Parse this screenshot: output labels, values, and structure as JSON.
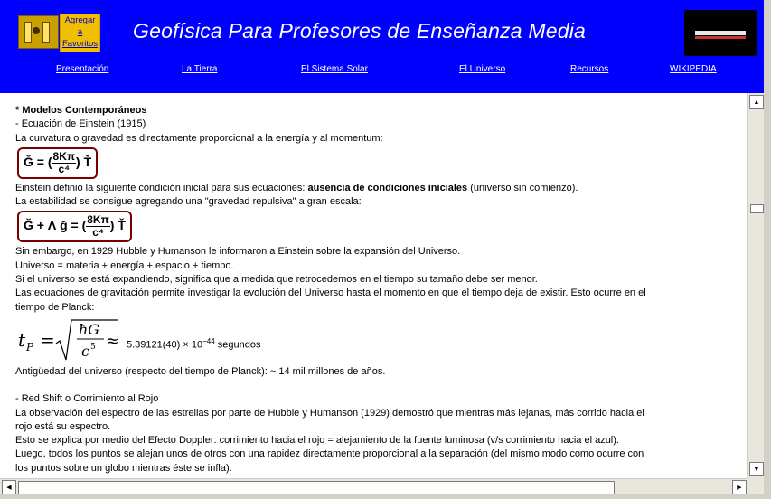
{
  "header": {
    "favorites_line1": "Agregar",
    "favorites_line2": "a",
    "favorites_line3": "Favoritos",
    "title": "Geofísica Para Profesores de Enseñanza Media",
    "bg_color": "#0000ff"
  },
  "nav": {
    "items": [
      {
        "label": "Presentación"
      },
      {
        "label": "La Tierra"
      },
      {
        "label": "El Sistema Solar"
      },
      {
        "label": "El Universo"
      },
      {
        "label": "Recursos"
      },
      {
        "label": "WIKIPEDIA"
      }
    ]
  },
  "content": {
    "section_title": "* Modelos Contemporáneos",
    "einstein_heading": "- Ecuación de Einstein (1915)",
    "curvature_text": "La curvatura o gravedad es directamente proporcional a la energía y al momentum:",
    "eq1": {
      "left": "Ğ = (",
      "num": "8Kπ",
      "den": "c⁴",
      "right": ") Ť"
    },
    "initial_condition_pre": "Einstein definió la siguiente condición inicial para sus ecuaciones: ",
    "initial_condition_bold": "ausencia de condiciones iniciales",
    "initial_condition_post": " (universo sin comienzo).",
    "stability_text": "La estabilidad se consigue agregando una \"gravedad repulsiva\" a gran escala:",
    "eq2": {
      "left": "Ğ + Λ ğ = (",
      "num": "8Kπ",
      "den": "c⁴",
      "right": ") Ť"
    },
    "hubble_text": "Sin embargo, en 1929 Hubble y Humanson le informaron a Einstein sobre la expansión del Universo.",
    "universe_text": "Universo = materia + energía + espacio + tiempo.",
    "expanding_text": "Si el universo se está expandiendo, significa que a medida que retrocedemos en el tiempo su tamaño debe ser menor.",
    "gravitation_text_1": "Las ecuaciones de gravitación permite investigar la evolución del Universo hasta el momento en que el tiempo deja de existir. Esto ocurre en el",
    "gravitation_text_2": "tiempo de Planck:",
    "planck_value": "5.39121(40) × 10",
    "planck_exp": "−44",
    "planck_unit": " segundos",
    "age_text": "Antigüedad del universo (respecto del tiempo de Planck): ~ 14 mil millones de años.",
    "redshift_heading": "- Red Shift o Corrimiento al Rojo",
    "redshift_text_1": "La observación del espectro de las estrellas por parte de Hubble y Humanson (1929) demostró que mientras más lejanas, más corrido hacia el",
    "redshift_text_2": "rojo está su espectro.",
    "doppler_text": "Esto se explica por medio del Efecto Doppler: corrimiento hacia el rojo = alejamiento de la fuente luminosa (v/s corrimiento hacia el azul).",
    "separation_text_1": "Luego, todos los puntos se alejan unos de otros con una rapidez directamente proporcional a la separación (del mismo modo como ocurre con",
    "separation_text_2": "los puntos sobre un globo mientras éste se infla)."
  }
}
